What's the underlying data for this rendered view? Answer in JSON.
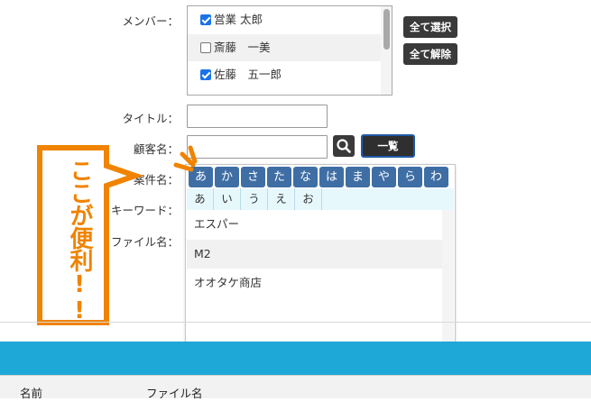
{
  "form": {
    "member_label": "メンバー：",
    "title_label": "タイトル：",
    "customer_label": "顧客名：",
    "case_label": "案件名：",
    "keyword_label": "キーワード：",
    "file_label": "ファイル名："
  },
  "members": [
    {
      "name": "営業 太郎",
      "checked": true
    },
    {
      "name": "斎藤　一美",
      "checked": false
    },
    {
      "name": "佐藤　五一郎",
      "checked": true
    }
  ],
  "buttons": {
    "select_all": "全て選択",
    "deselect_all": "全て解除",
    "list": "一覧"
  },
  "inputs": {
    "title_value": "",
    "customer_value": ""
  },
  "gojuon": [
    "あ",
    "か",
    "さ",
    "た",
    "な",
    "は",
    "ま",
    "や",
    "ら",
    "わ"
  ],
  "kana": [
    "あ",
    "い",
    "う",
    "え",
    "お"
  ],
  "customer_list": [
    "エスパー",
    "M2",
    "オオタケ商店"
  ],
  "callout": {
    "text": "ここが便利!!",
    "color": "#f08300"
  },
  "table": {
    "columns": [
      "名前",
      "ファイル名"
    ]
  },
  "colors": {
    "accent_blue": "#1ea8d8",
    "gojuon_button": "#3f6ea5",
    "dark_button": "#3a3a3a"
  }
}
